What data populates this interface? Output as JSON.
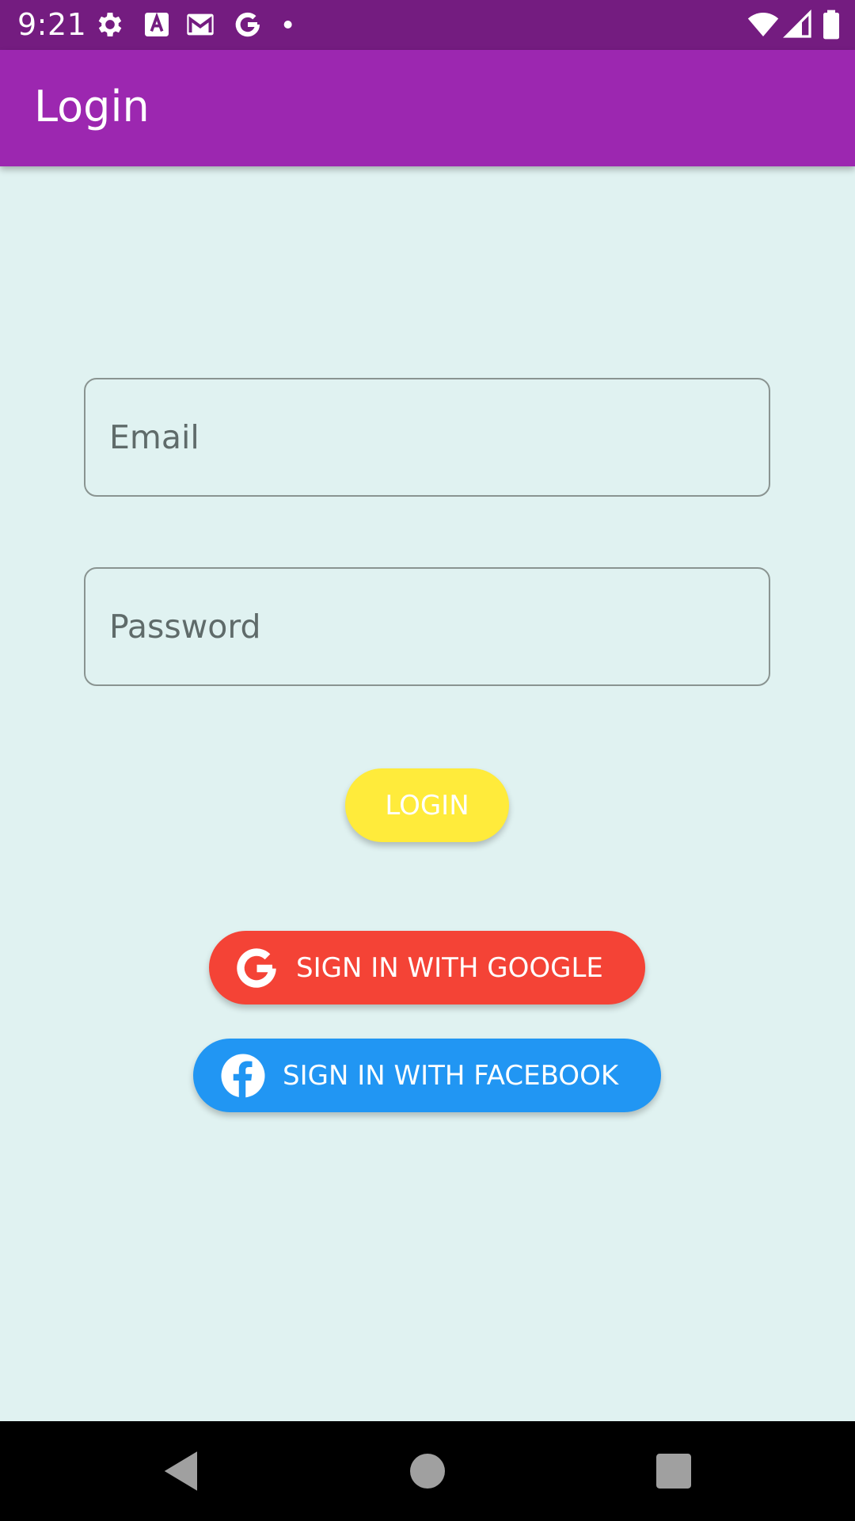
{
  "status_bar": {
    "time": "9:21",
    "icons": [
      "settings-icon",
      "text-a-icon",
      "gmail-icon",
      "google-icon",
      "dot-icon",
      "wifi-icon",
      "signal-icon",
      "battery-icon"
    ]
  },
  "app_bar": {
    "title": "Login",
    "color": "#9C27B0"
  },
  "form": {
    "email_placeholder": "Email",
    "email_value": "",
    "password_placeholder": "Password",
    "password_value": ""
  },
  "buttons": {
    "login_label": "LOGIN",
    "login_color": "#FFEB3B",
    "google_label": "SIGN IN WITH GOOGLE",
    "google_icon": "google-icon",
    "google_color": "#F44336",
    "facebook_label": "SIGN IN WITH FACEBOOK",
    "facebook_icon": "facebook-icon",
    "facebook_color": "#2196F3"
  },
  "nav_bar": {
    "icons": [
      "back-icon",
      "home-icon",
      "recents-icon"
    ]
  },
  "colors": {
    "status_bar": "#741C80",
    "background": "#E0F2F1"
  }
}
